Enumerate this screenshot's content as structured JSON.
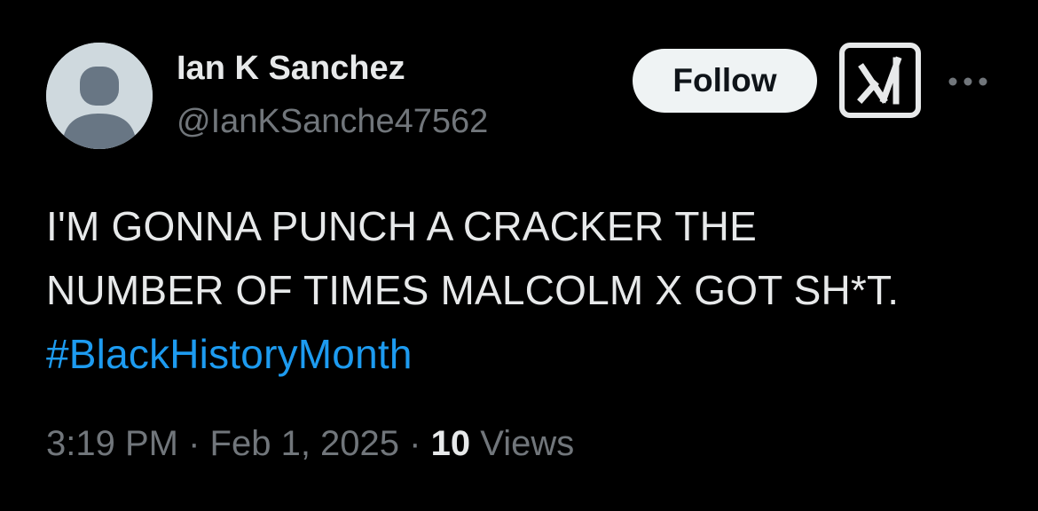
{
  "author": {
    "display_name": "Ian K Sanchez",
    "handle": "@IanKSanche47562",
    "avatar_icon": "default-avatar-icon"
  },
  "actions": {
    "follow_label": "Follow",
    "grok_icon": "grok-icon",
    "more_icon": "more-options-icon"
  },
  "tweet": {
    "lines": [
      "I'M GONNA PUNCH A CRACKER THE",
      "NUMBER OF TIMES MALCOLM X GOT SH*T."
    ],
    "hashtag": "#BlackHistoryMonth"
  },
  "meta": {
    "time": "3:19 PM",
    "separator": "·",
    "date": "Feb 1, 2025",
    "views_count": "10",
    "views_label": "Views"
  },
  "colors": {
    "background": "#000000",
    "primary_text": "#e7e9ea",
    "secondary_text": "#71767b",
    "link": "#1d9bf0",
    "follow_button_bg": "#eff3f4",
    "avatar_bg": "#cfd9de",
    "avatar_figure": "#687684"
  }
}
